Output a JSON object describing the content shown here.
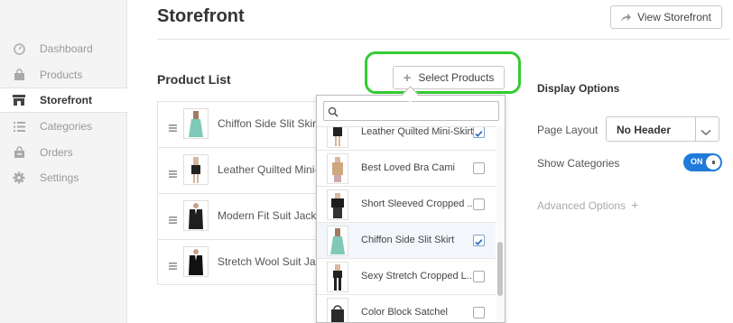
{
  "sidebar": {
    "items": [
      {
        "label": "Dashboard",
        "icon": "dashboard-icon",
        "active": false
      },
      {
        "label": "Products",
        "icon": "shopping-bag-icon",
        "active": false
      },
      {
        "label": "Storefront",
        "icon": "storefront-icon",
        "active": true
      },
      {
        "label": "Categories",
        "icon": "list-icon",
        "active": false
      },
      {
        "label": "Orders",
        "icon": "orders-bag-icon",
        "active": false
      },
      {
        "label": "Settings",
        "icon": "gear-icon",
        "active": false
      }
    ]
  },
  "header": {
    "title": "Storefront",
    "view_button": "View Storefront"
  },
  "product_list": {
    "title": "Product List",
    "select_button": "Select Products",
    "rows": [
      {
        "label": "Chiffon Side Slit Skirt"
      },
      {
        "label": "Leather Quilted Mini-Skirt"
      },
      {
        "label": "Modern Fit Suit Jacket"
      },
      {
        "label": "Stretch Wool Suit Jacket"
      }
    ]
  },
  "dropdown": {
    "search_placeholder": "",
    "items": [
      {
        "label": "Leather Quilted Mini-Skirt",
        "checked": true
      },
      {
        "label": "Best Loved Bra Cami",
        "checked": false
      },
      {
        "label": "Short Sleeved Cropped ...",
        "checked": false
      },
      {
        "label": "Chiffon Side Slit Skirt",
        "checked": true
      },
      {
        "label": "Sexy Stretch Cropped L...",
        "checked": false
      },
      {
        "label": "Color Block Satchel",
        "checked": false
      }
    ]
  },
  "display_options": {
    "title": "Display Options",
    "page_layout_label": "Page Layout",
    "page_layout_value": "No Header",
    "show_categories_label": "Show Categories",
    "toggle_label": "ON",
    "advanced_label": "Advanced Options",
    "advanced_plus": "+"
  },
  "colors": {
    "accent": "#1f7bd9",
    "highlight": "#33cc33"
  }
}
